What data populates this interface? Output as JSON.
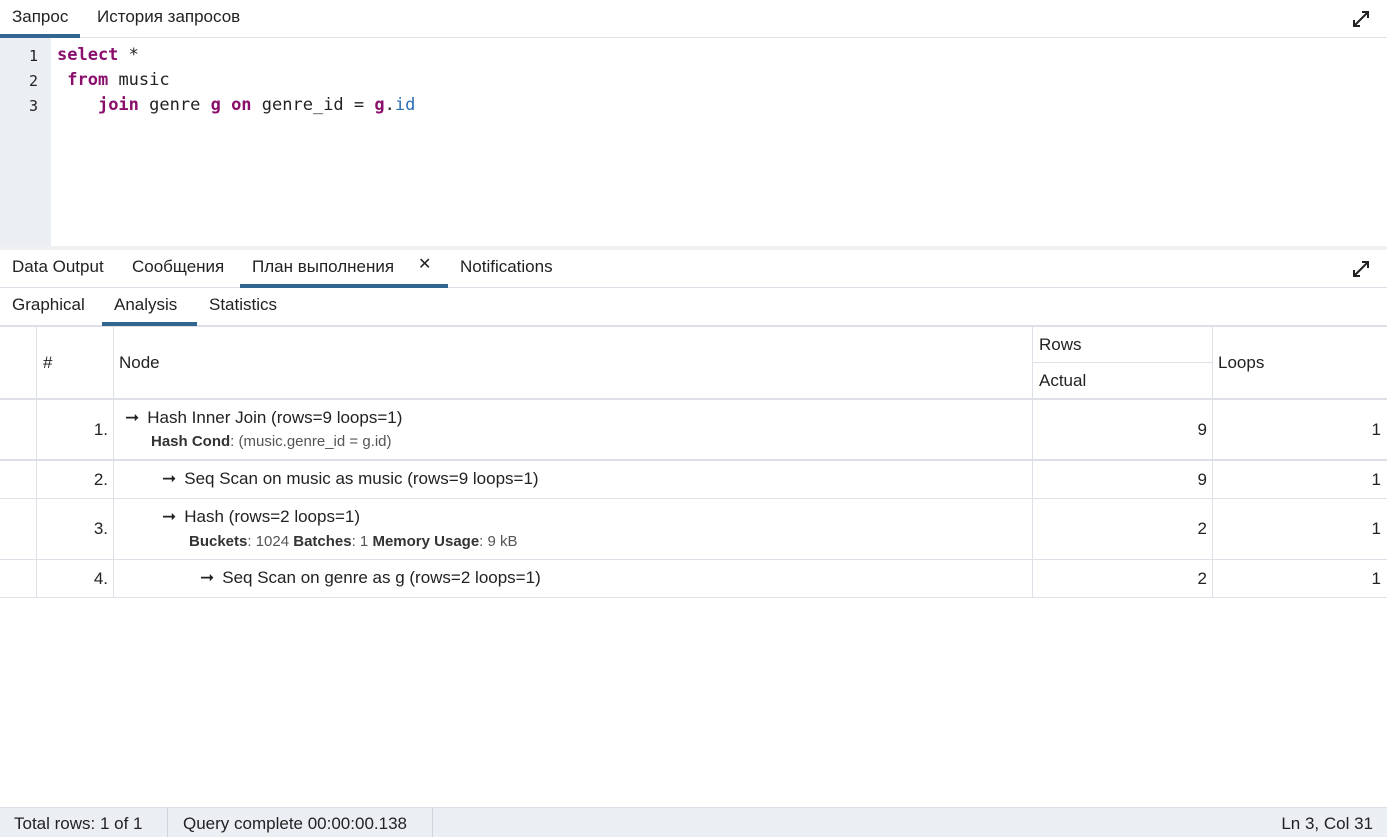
{
  "top_tabs": [
    "Запрос",
    "История запросов"
  ],
  "editor": {
    "line_numbers": [
      "1",
      "2",
      "3"
    ],
    "lines": [
      [
        {
          "t": "select",
          "c": "kw"
        },
        {
          "t": " *",
          "c": ""
        }
      ],
      [
        {
          "t": " ",
          "c": ""
        },
        {
          "t": "from",
          "c": "kw"
        },
        {
          "t": " music",
          "c": ""
        }
      ],
      [
        {
          "t": "    ",
          "c": ""
        },
        {
          "t": "join",
          "c": "kw"
        },
        {
          "t": " genre ",
          "c": ""
        },
        {
          "t": "g",
          "c": "kw"
        },
        {
          "t": " ",
          "c": ""
        },
        {
          "t": "on",
          "c": "kw"
        },
        {
          "t": " genre_id = ",
          "c": ""
        },
        {
          "t": "g",
          "c": "kw"
        },
        {
          "t": ".",
          "c": ""
        },
        {
          "t": "id",
          "c": "fld"
        }
      ]
    ]
  },
  "output_tabs": {
    "data_output": "Data Output",
    "messages": "Сообщения",
    "plan": "План выполнения",
    "plan_close": "✕",
    "notifications": "Notifications"
  },
  "plan_subtabs": {
    "graphical": "Graphical",
    "analysis": "Analysis",
    "statistics": "Statistics"
  },
  "table": {
    "headers": {
      "num": "#",
      "node": "Node",
      "rows_group": "Rows",
      "actual": "Actual",
      "loops": "Loops"
    },
    "rows": [
      {
        "num": "1.",
        "node": "Hash Inner Join (rows=9 loops=1)",
        "details": [
          {
            "k": "Hash Cond",
            "v": ": (music.genre_id = g.id)"
          }
        ],
        "actual": "9",
        "loops": "1"
      },
      {
        "num": "2.",
        "node": "Seq Scan on music as music (rows=9 loops=1)",
        "details": [],
        "actual": "9",
        "loops": "1"
      },
      {
        "num": "3.",
        "node": "Hash (rows=2 loops=1)",
        "details": [
          {
            "k": "Buckets",
            "v": ": 1024 "
          },
          {
            "k": "Batches",
            "v": ": 1 "
          },
          {
            "k": "Memory Usage",
            "v": ": 9 kB"
          }
        ],
        "actual": "2",
        "loops": "1"
      },
      {
        "num": "4.",
        "node": "Seq Scan on genre as g (rows=2 loops=1)",
        "details": [],
        "actual": "2",
        "loops": "1"
      }
    ]
  },
  "status": {
    "total_rows": "Total rows: 1 of 1",
    "query_complete": "Query complete 00:00:00.138",
    "cursor": "Ln 3, Col 31"
  },
  "icons": {
    "expand": "expand-icon",
    "arrow": "arrow-right-icon",
    "close": "close-icon"
  },
  "colors": {
    "accent": "#326690",
    "keyword": "#8a0e6b",
    "field": "#2b6eb5"
  }
}
